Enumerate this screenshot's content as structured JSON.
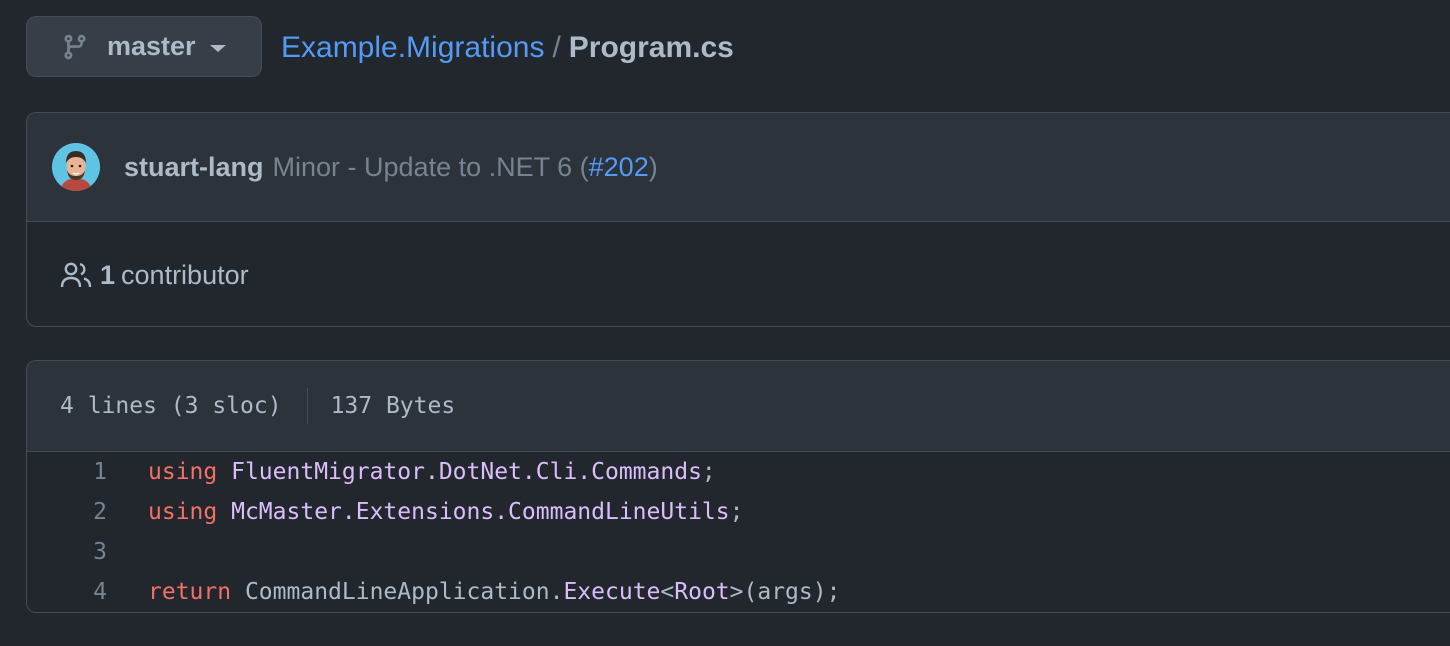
{
  "branch": {
    "name": "master"
  },
  "breadcrumb": {
    "repo": "Example.Migrations",
    "separator": "/",
    "file": "Program.cs"
  },
  "commit": {
    "author": "stuart-lang",
    "message_prefix": "Minor - Update to .NET 6 (",
    "pr_link": "#202",
    "message_suffix": ")"
  },
  "contributors": {
    "count": "1",
    "label": "contributor"
  },
  "file_info": {
    "lines": "4 lines (3 sloc)",
    "size": "137 Bytes"
  },
  "code": {
    "lines": [
      {
        "num": "1",
        "kw": "using",
        "text1": "FluentMigrator.DotNet.Cli.Commands",
        "text2": ";"
      },
      {
        "num": "2",
        "kw": "using",
        "text1": "McMaster.Extensions.CommandLineUtils",
        "text2": ";"
      },
      {
        "num": "3",
        "kw": "",
        "text1": "",
        "text2": ""
      },
      {
        "num": "4",
        "kw": "return",
        "text1": "CommandLineApplication.",
        "call": "Execute",
        "generic_open": "<",
        "generic": "Root",
        "generic_close": ">",
        "text2": "(args);"
      }
    ]
  },
  "colors": {
    "background": "#22272e",
    "keyword": "#f47067",
    "namespace": "#dcbdfb",
    "link": "#539bf5"
  }
}
